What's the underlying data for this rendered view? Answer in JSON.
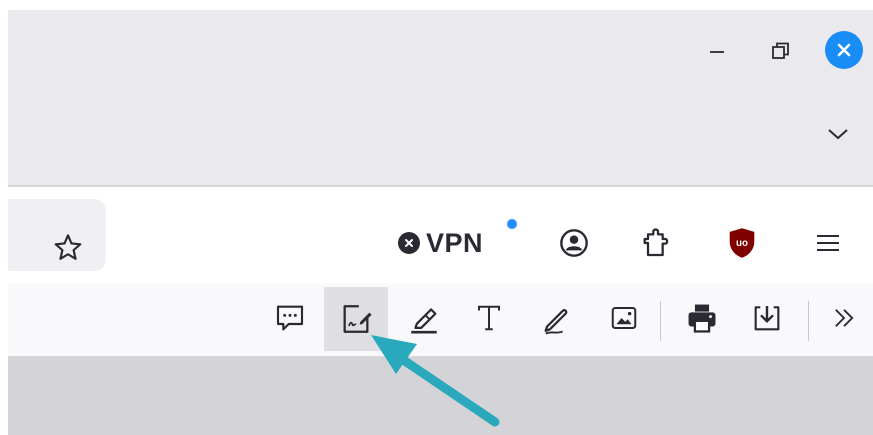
{
  "window_controls": {
    "minimize_icon": "minimize-icon",
    "restore_icon": "restore-icon",
    "close_icon": "close-icon",
    "close_color": "#1a8cf5"
  },
  "tabs": {
    "list_all_icon": "chevron-down-icon"
  },
  "navbar": {
    "bookmark_icon": "star-icon",
    "vpn": {
      "label": "VPN",
      "status_icon": "vpn-off-icon",
      "notification_color": "#1e90ff"
    },
    "account_icon": "account-icon",
    "extensions_icon": "puzzle-icon",
    "ublock_icon": "ublock-origin-icon",
    "ublock_badge": "uo",
    "ublock_color": "#800000",
    "menu_icon": "hamburger-icon"
  },
  "pdf_toolbar": {
    "tools": [
      {
        "name": "comment",
        "icon": "comment-icon",
        "active": false
      },
      {
        "name": "signature",
        "icon": "signature-icon",
        "active": true
      },
      {
        "name": "highlight",
        "icon": "highlighter-icon",
        "active": false
      },
      {
        "name": "text",
        "icon": "text-icon",
        "active": false
      },
      {
        "name": "draw",
        "icon": "pen-icon",
        "active": false
      },
      {
        "name": "image",
        "icon": "image-icon",
        "active": false
      },
      {
        "name": "print",
        "icon": "print-icon",
        "active": false
      },
      {
        "name": "save",
        "icon": "download-icon",
        "active": false
      },
      {
        "name": "more",
        "icon": "chevron-double-right-icon",
        "active": false
      }
    ]
  },
  "annotation": {
    "arrow_color": "#2aa9bd",
    "points_to": "signature"
  }
}
